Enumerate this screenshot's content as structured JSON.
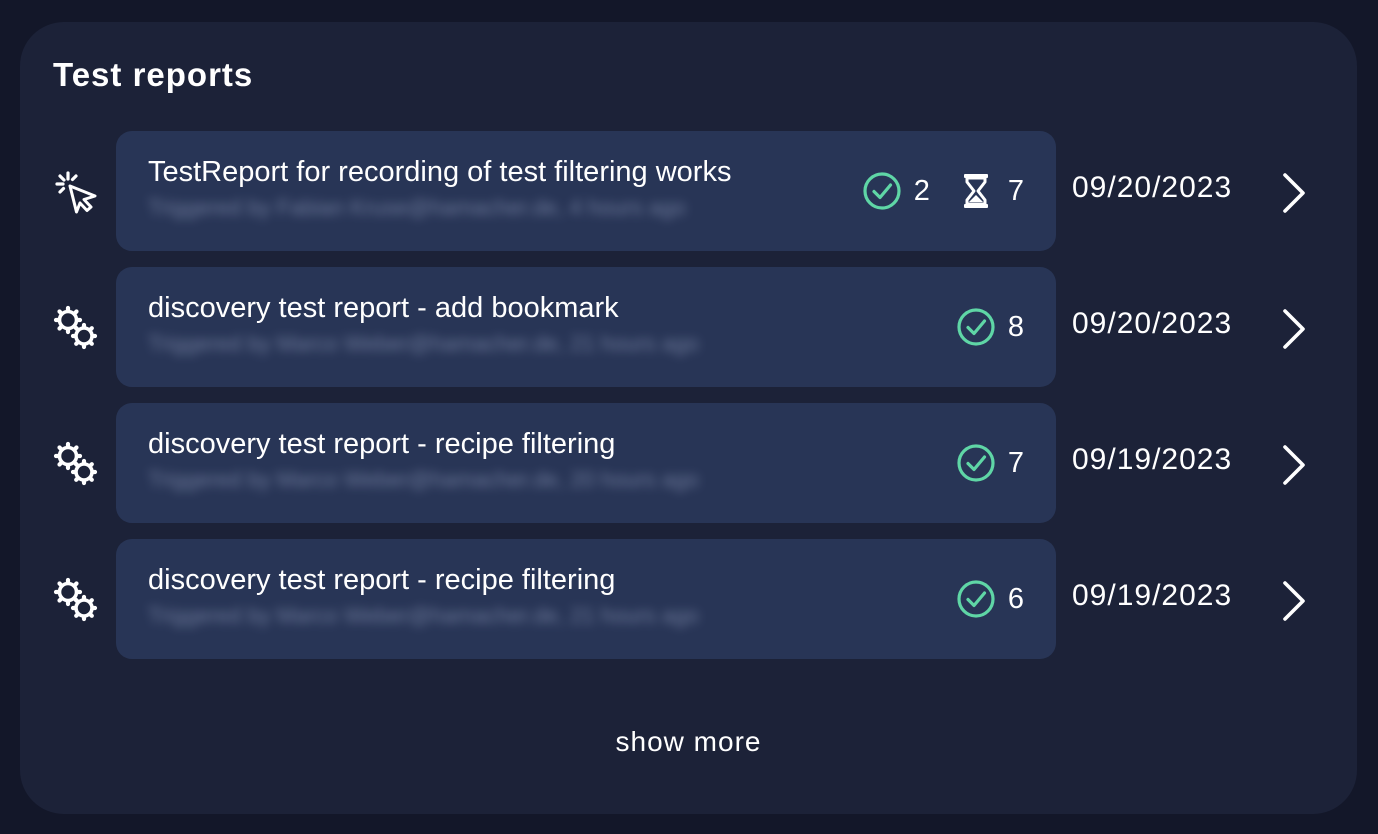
{
  "panel": {
    "title": "Test reports",
    "show_more_label": "show more"
  },
  "colors": {
    "page_background": "#131729",
    "panel_background": "#1c2238",
    "card_background": "#283556",
    "success_accent": "#5fd6a6"
  },
  "reports": [
    {
      "type_icon": "recording-cursor-icon",
      "title": "TestReport for recording of test filtering works",
      "subtitle": "Triggered by Fabian Kruse@hamacher.de, 4 hours ago",
      "passed": "2",
      "pending": "7",
      "date": "09/20/2023"
    },
    {
      "type_icon": "gears-icon",
      "title": "discovery test report - add bookmark",
      "subtitle": "Triggered by Marco Weber@hamacher.de, 21 hours ago",
      "passed": "8",
      "pending": null,
      "date": "09/20/2023"
    },
    {
      "type_icon": "gears-icon",
      "title": "discovery test report - recipe filtering",
      "subtitle": "Triggered by Marco Weber@hamacher.de, 20 hours ago",
      "passed": "7",
      "pending": null,
      "date": "09/19/2023"
    },
    {
      "type_icon": "gears-icon",
      "title": "discovery test report - recipe filtering",
      "subtitle": "Triggered by Marco Weber@hamacher.de, 21 hours ago",
      "passed": "6",
      "pending": null,
      "date": "09/19/2023"
    }
  ]
}
